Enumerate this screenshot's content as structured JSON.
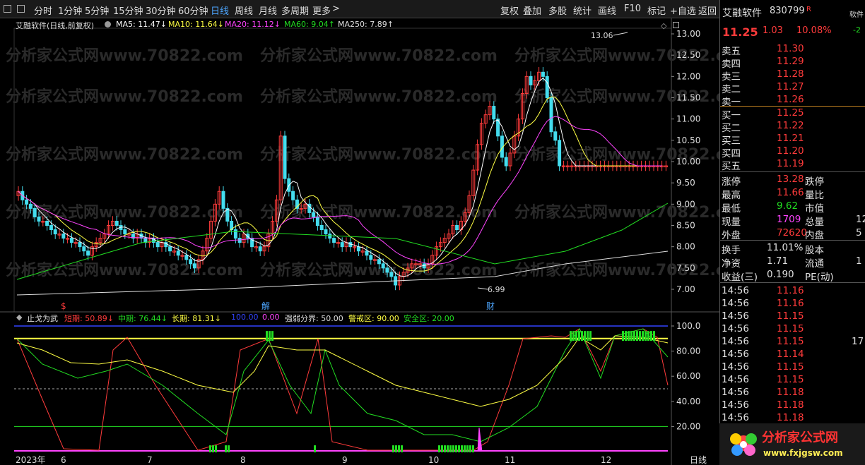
{
  "toolbar": {
    "periods": [
      "分时",
      "1分钟",
      "5分钟",
      "15分钟",
      "30分钟",
      "60分钟",
      "日线",
      "周线",
      "月线",
      "多周期",
      "更多"
    ],
    "more_arrow": ">",
    "right_buttons": [
      "复权",
      "叠加",
      "多股",
      "统计",
      "画线",
      "F10",
      "标记",
      "+自选",
      "返回"
    ]
  },
  "chart_title": "艾融软件(日线,前复权)",
  "ma_labels": [
    {
      "text": "MA5: 11.47↓",
      "color": "#ffffff"
    },
    {
      "text": "MA10: 11.64↓",
      "color": "#ffff44"
    },
    {
      "text": "MA20: 11.12↓",
      "color": "#ff44ff"
    },
    {
      "text": "MA60: 9.04↑",
      "color": "#22dd22"
    },
    {
      "text": "MA250: 7.89↑",
      "color": "#e0e0e0"
    }
  ],
  "price_axis": [
    "13.00",
    "12.50",
    "12.00",
    "11.50",
    "11.00",
    "10.50",
    "10.00",
    "9.50",
    "9.00",
    "8.50",
    "8.00",
    "7.50",
    "7.00"
  ],
  "high_label": "13.06",
  "low_label": "6.99",
  "markers": [
    "$",
    "解",
    "财"
  ],
  "indicator": {
    "name": "止戈为武",
    "short": "短期: 50.89↓",
    "mid": "中期: 76.44↓",
    "long": "长期: 81.31↓",
    "blue": "100.00",
    "purple": "0.00",
    "strong_weak": "强弱分界: 50.00",
    "warn": "警戒区: 90.00",
    "safe": "安全区: 20.00"
  },
  "indicator_axis": [
    "100.0",
    "80.00",
    "60.00",
    "40.00",
    "20.00"
  ],
  "time_axis": [
    "2023年",
    "6",
    "7",
    "8",
    "9",
    "10",
    "11",
    "12"
  ],
  "period_label": "日线",
  "watermark": "分析家公式网www.70822.com",
  "quote": {
    "name": "艾融软件",
    "code": "830799",
    "flag": "R",
    "price": "11.25",
    "change": "1.03",
    "pct": "10.08%",
    "side_label": "软件",
    "side_value": "-2",
    "asks": [
      {
        "label": "卖五",
        "price": "11.30"
      },
      {
        "label": "卖四",
        "price": "11.29"
      },
      {
        "label": "卖三",
        "price": "11.28"
      },
      {
        "label": "卖二",
        "price": "11.27"
      },
      {
        "label": "卖一",
        "price": "11.26"
      }
    ],
    "bids": [
      {
        "label": "买一",
        "price": "11.25"
      },
      {
        "label": "买二",
        "price": "11.22"
      },
      {
        "label": "买三",
        "price": "11.21"
      },
      {
        "label": "买四",
        "price": "11.20"
      },
      {
        "label": "买五",
        "price": "11.19"
      }
    ],
    "stats": [
      {
        "l1": "涨停",
        "v1": "13.28",
        "c1": "red",
        "l2": "跌停",
        "v2": ""
      },
      {
        "l1": "最高",
        "v1": "11.66",
        "c1": "red",
        "l2": "量比",
        "v2": ""
      },
      {
        "l1": "最低",
        "v1": "9.62",
        "c1": "green",
        "l2": "市值",
        "v2": ""
      },
      {
        "l1": "现量",
        "v1": "1709",
        "c1": "mag",
        "l2": "总量",
        "v2": "12"
      },
      {
        "l1": "外盘",
        "v1": "72620",
        "c1": "red",
        "l2": "内盘",
        "v2": "5"
      }
    ],
    "stats2": [
      {
        "l1": "换手",
        "v1": "11.01%",
        "l2": "股本",
        "v2": ""
      },
      {
        "l1": "净资",
        "v1": "1.71",
        "l2": "流通",
        "v2": "1"
      },
      {
        "l1": "收益(三)",
        "v1": "0.190",
        "l2": "PE(动)",
        "v2": ""
      }
    ],
    "ticks": [
      {
        "t": "14:56",
        "p": "11.16",
        "v": ""
      },
      {
        "t": "14:56",
        "p": "11.16",
        "v": ""
      },
      {
        "t": "14:56",
        "p": "11.15",
        "v": ""
      },
      {
        "t": "14:56",
        "p": "11.15",
        "v": ""
      },
      {
        "t": "14:56",
        "p": "11.15",
        "v": "17"
      },
      {
        "t": "14:56",
        "p": "11.14",
        "v": ""
      },
      {
        "t": "14:56",
        "p": "11.15",
        "v": ""
      },
      {
        "t": "14:56",
        "p": "11.15",
        "v": ""
      },
      {
        "t": "14:56",
        "p": "11.18",
        "v": ""
      },
      {
        "t": "14:56",
        "p": "11.18",
        "v": ""
      },
      {
        "t": "14:56",
        "p": "11.18",
        "v": ""
      }
    ]
  },
  "logo": {
    "text": "分析家公式网",
    "url": "www.fxjgsw.com"
  }
}
